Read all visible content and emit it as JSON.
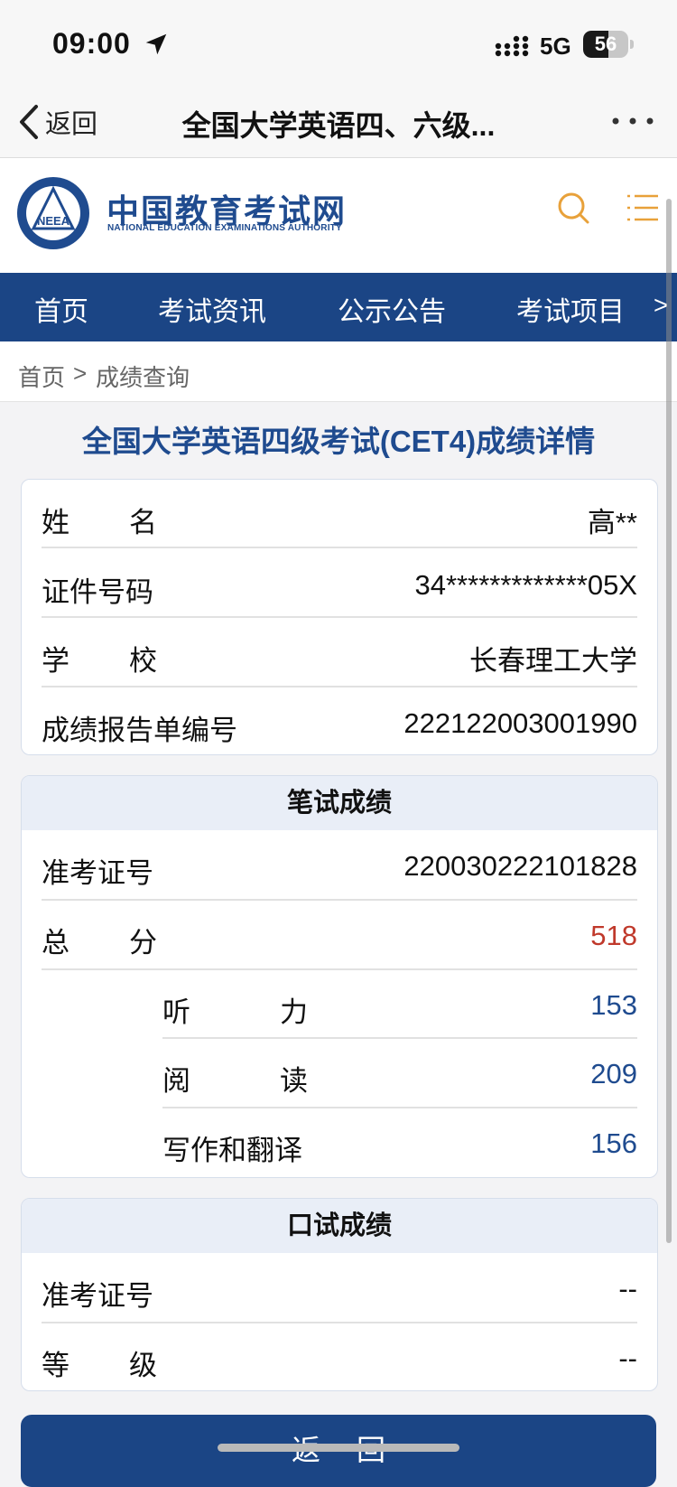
{
  "status_bar": {
    "time": "09:00",
    "network": "5G",
    "battery": "56",
    "battery_level": 0.56,
    "icons": [
      "location-arrow-icon",
      "signal-icon",
      "battery-icon"
    ]
  },
  "nav_bar": {
    "back_label": "返回",
    "title": "全国大学英语四、六级...",
    "icons": [
      "chevron-left-icon",
      "more-dots-icon"
    ]
  },
  "site": {
    "name_cn": "中国教育考试网",
    "name_en": "NATIONAL EDUCATION EXAMINATIONS AUTHORITY",
    "emblem_text": "NEEA",
    "icons": [
      "search-icon",
      "menu-icon"
    ],
    "accent_color": "#e8a13a",
    "brand_color": "#1b4585"
  },
  "main_nav": {
    "items": [
      "首页",
      "考试资讯",
      "公示公告",
      "考试项目"
    ],
    "more": ">"
  },
  "breadcrumb": {
    "home": "首页",
    "separator": ">",
    "current": "成绩查询"
  },
  "page_title": "全国大学英语四级考试(CET4)成绩详情",
  "personal": {
    "name": {
      "label": [
        "姓",
        "名"
      ],
      "value": "高**"
    },
    "id_number": {
      "label": "证件号码",
      "value": "34*************05X"
    },
    "school": {
      "label": [
        "学",
        "校"
      ],
      "value": "长春理工大学"
    },
    "report_no": {
      "label": "成绩报告单编号",
      "value": "222122003001990"
    }
  },
  "written": {
    "header": "笔试成绩",
    "ticket": {
      "label": "准考证号",
      "value": "220030222101828"
    },
    "total": {
      "label": [
        "总",
        "分"
      ],
      "value": "518",
      "color": "#c0392b"
    },
    "listening": {
      "label": [
        "听",
        "力"
      ],
      "value": "153"
    },
    "reading": {
      "label": [
        "阅",
        "读"
      ],
      "value": "209"
    },
    "writing": {
      "label": "写作和翻译",
      "value": "156"
    },
    "score_color": "#1f4b8f"
  },
  "oral": {
    "header": "口试成绩",
    "ticket": {
      "label": "准考证号",
      "value": "--"
    },
    "grade": {
      "label": [
        "等",
        "级"
      ],
      "value": "--"
    }
  },
  "return_button": "返回"
}
